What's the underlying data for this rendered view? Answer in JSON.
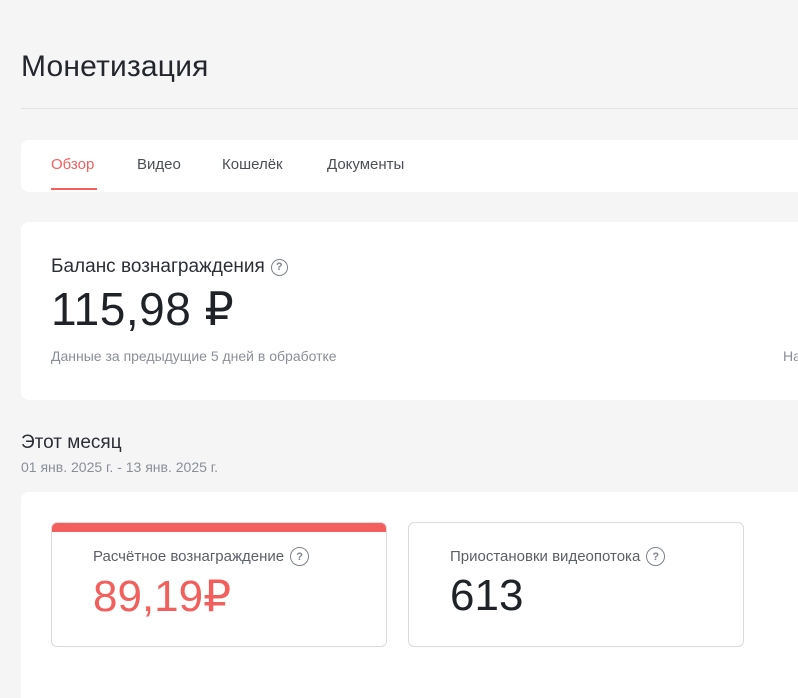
{
  "page": {
    "title": "Монетизация"
  },
  "tabs": [
    {
      "label": "Обзор",
      "active": true
    },
    {
      "label": "Видео",
      "active": false
    },
    {
      "label": "Кошелёк",
      "active": false
    },
    {
      "label": "Документы",
      "active": false
    }
  ],
  "balance": {
    "label": "Баланс вознаграждения",
    "value": "115,98 ₽",
    "note": "Данные за предыдущие 5 дней в обработке",
    "right_stub": "На"
  },
  "month": {
    "title": "Этот месяц",
    "range": "01 янв. 2025 г. - 13 янв. 2025 г."
  },
  "stats": [
    {
      "label": "Расчётное вознаграждение",
      "value": "89,19₽"
    },
    {
      "label": "Приостановки видеопотока",
      "value": "613"
    }
  ],
  "colors": {
    "accent": "#f25f5c",
    "background": "#f5f5f6",
    "card": "#ffffff"
  },
  "icons": {
    "help": "help-circle-icon"
  }
}
